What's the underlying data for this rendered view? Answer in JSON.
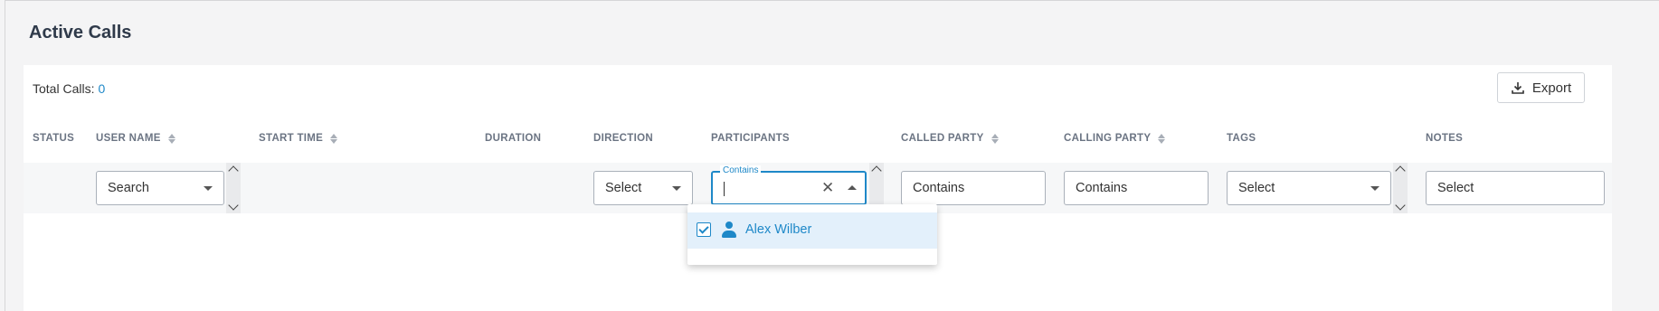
{
  "page": {
    "title": "Active Calls"
  },
  "summary": {
    "total_label": "Total Calls:",
    "total_value": "0"
  },
  "toolbar": {
    "export_label": "Export"
  },
  "columns": {
    "status": "STATUS",
    "user_name": "USER NAME",
    "start_time": "START TIME",
    "duration": "DURATION",
    "direction": "DIRECTION",
    "participants": "PARTICIPANTS",
    "called_party": "CALLED PARTY",
    "calling_party": "CALLING PARTY",
    "tags": "TAGS",
    "notes": "NOTES"
  },
  "filters": {
    "user_name": "Search",
    "direction": "Select",
    "participants_legend": "Contains",
    "participants_value": "",
    "called_party": "Contains",
    "calling_party": "Contains",
    "tags": "Select",
    "notes": "Select"
  },
  "participants_dropdown": {
    "options": [
      {
        "label": "Alex Wilber",
        "checked": true
      }
    ]
  },
  "colors": {
    "accent": "#1e88c8",
    "title": "#2f3a4a",
    "header": "#6b7483"
  }
}
